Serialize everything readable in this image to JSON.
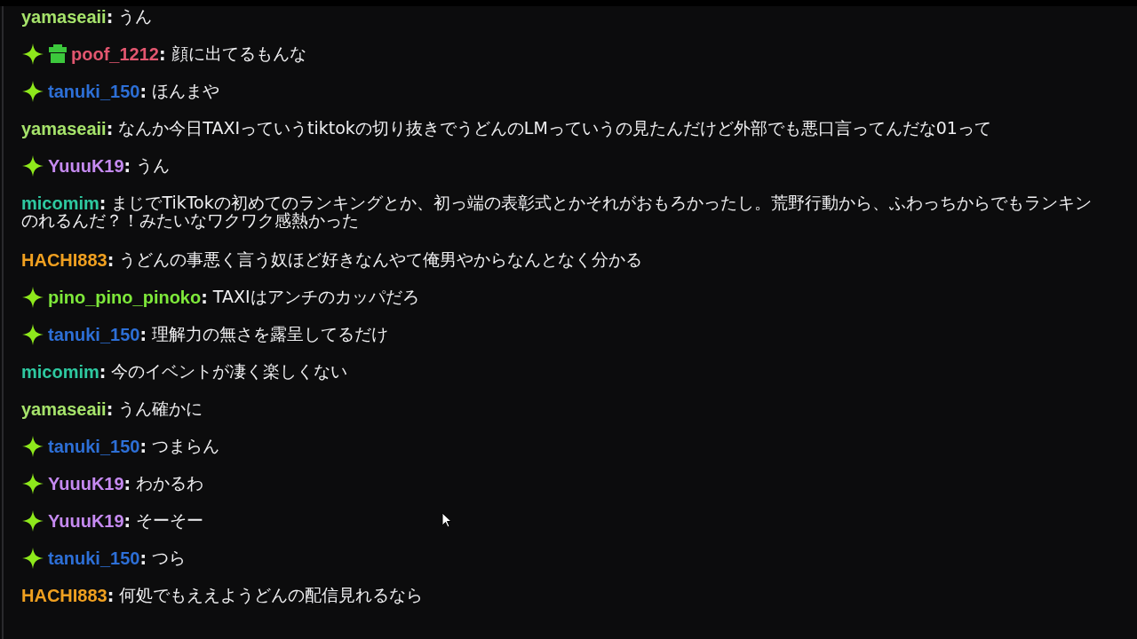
{
  "chat": {
    "messages": [
      {
        "user": "yamaseaii",
        "separator": ":",
        "color": "#a6e36b",
        "lines": [
          "うん"
        ]
      },
      {
        "badges": [
          {
            "kind": "sparkle"
          },
          {
            "kind": "gift"
          }
        ],
        "user": "poof_1212",
        "separator": ":",
        "color": "#e2566f",
        "lines": [
          "顔に出てるもんな"
        ]
      },
      {
        "badges": [
          {
            "kind": "sparkle"
          }
        ],
        "user": "tanuki_150",
        "separator": ":",
        "color": "#2d6fd6",
        "lines": [
          "ほんまや"
        ]
      },
      {
        "user": "yamaseaii",
        "separator": ":",
        "color": "#a6e36b",
        "lines": [
          "なんか今日TAXIっていうtiktokの切り抜きでうどんのLMっていうの見たんだけど外部でも悪口言ってんだな01って"
        ]
      },
      {
        "badges": [
          {
            "kind": "sparkle"
          }
        ],
        "user": "YuuuK19",
        "separator": ":",
        "color": "#c58af0",
        "lines": [
          "うん"
        ]
      },
      {
        "user": "micomim",
        "separator": ":",
        "color": "#2ec9a0",
        "lines": [
          "まじでTikTokの初めてのランキングとか、初っ端の表彰式とかそれがおもろかったし。荒野行動から、ふわっちからでもランキン",
          "のれるんだ？！みたいなワクワク感熱かった"
        ]
      },
      {
        "user": "HACHI883",
        "separator": ":",
        "color": "#f0a020",
        "lines": [
          "うどんの事悪く言う奴ほど好きなんやて俺男やからなんとなく分かる"
        ]
      },
      {
        "badges": [
          {
            "kind": "sparkle"
          }
        ],
        "user": "pino_pino_pinoko",
        "separator": ":",
        "color": "#7ee83a",
        "lines": [
          "TAXIはアンチのカッパだろ"
        ]
      },
      {
        "badges": [
          {
            "kind": "sparkle"
          }
        ],
        "user": "tanuki_150",
        "separator": ":",
        "color": "#2d6fd6",
        "lines": [
          "理解力の無さを露呈してるだけ"
        ]
      },
      {
        "user": "micomim",
        "separator": ":",
        "color": "#2ec9a0",
        "lines": [
          "今のイベントが凄く楽しくない"
        ]
      },
      {
        "user": "yamaseaii",
        "separator": ":",
        "color": "#a6e36b",
        "lines": [
          "うん確かに"
        ]
      },
      {
        "badges": [
          {
            "kind": "sparkle"
          }
        ],
        "user": "tanuki_150",
        "separator": ":",
        "color": "#2d6fd6",
        "lines": [
          "つまらん"
        ]
      },
      {
        "badges": [
          {
            "kind": "sparkle"
          }
        ],
        "user": "YuuuK19",
        "separator": ":",
        "color": "#c58af0",
        "lines": [
          "わかるわ"
        ]
      },
      {
        "badges": [
          {
            "kind": "sparkle"
          }
        ],
        "user": "YuuuK19",
        "separator": ":",
        "color": "#c58af0",
        "lines": [
          "そーそー"
        ]
      },
      {
        "badges": [
          {
            "kind": "sparkle"
          }
        ],
        "user": "tanuki_150",
        "separator": ":",
        "color": "#2d6fd6",
        "lines": [
          "つら"
        ]
      },
      {
        "user": "HACHI883",
        "separator": ":",
        "color": "#f0a020",
        "lines": [
          "何処でもええようどんの配信見れるなら"
        ]
      }
    ]
  }
}
